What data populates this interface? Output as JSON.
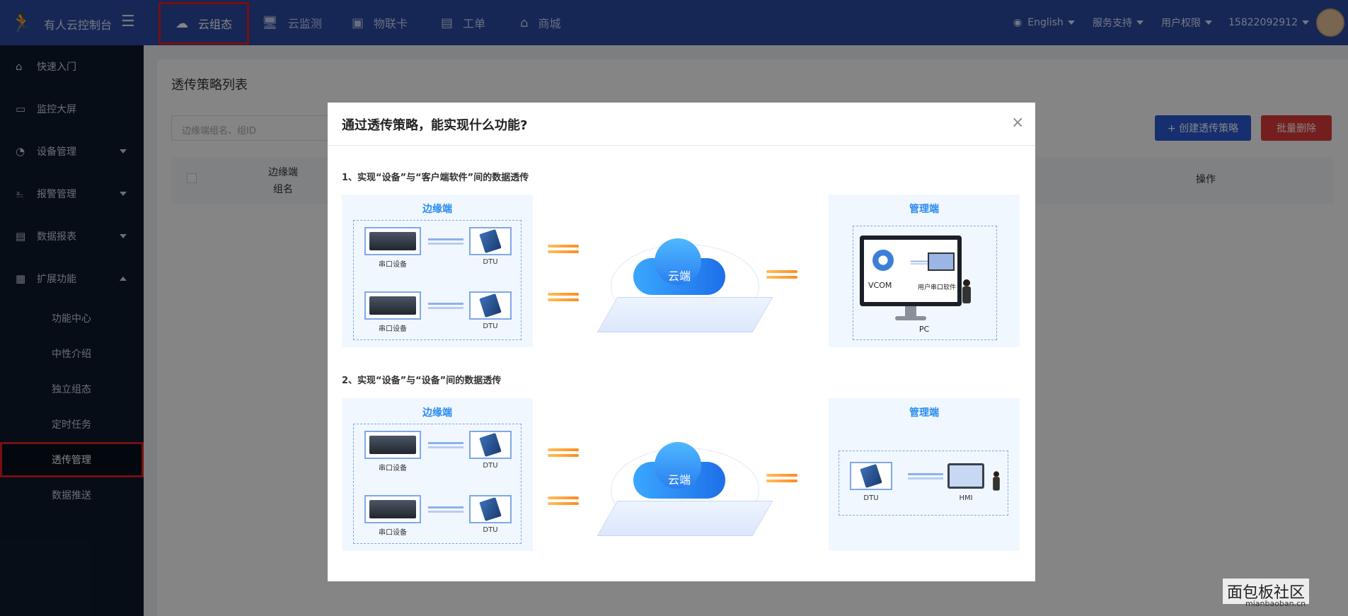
{
  "topbar": {
    "brand": "有人云控制台",
    "nav": [
      {
        "label": "云组态",
        "icon": "cloud-icon"
      },
      {
        "label": "云监测",
        "icon": "monitor-chart-icon"
      },
      {
        "label": "物联卡",
        "icon": "sim-card-icon"
      },
      {
        "label": "工单",
        "icon": "work-order-icon"
      },
      {
        "label": "商城",
        "icon": "store-icon"
      }
    ],
    "language": "English",
    "service": "服务支持",
    "permission": "用户权限",
    "user": "15822092912"
  },
  "sidebar": {
    "items": [
      {
        "label": "快速入门",
        "icon": "home-icon"
      },
      {
        "label": "监控大屏",
        "icon": "screen-icon"
      },
      {
        "label": "设备管理",
        "icon": "device-icon"
      },
      {
        "label": "报警管理",
        "icon": "bell-icon"
      },
      {
        "label": "数据报表",
        "icon": "report-icon"
      },
      {
        "label": "扩展功能",
        "icon": "grid-icon"
      }
    ],
    "sub": [
      "功能中心",
      "中性介绍",
      "独立组态",
      "定时任务",
      "透传管理",
      "数据推送"
    ]
  },
  "page": {
    "title": "透传策略列表",
    "search_placeholder": "边缘端组名、组ID",
    "create_button": "+ 创建透传策略",
    "delete_button": "批量删除",
    "col_group_line1": "边缘端",
    "col_group_line2": "组名",
    "col_ops": "操作"
  },
  "modal": {
    "title": "通过透传策略，能实现什么功能?",
    "section1": "1、实现“设备”与“客户端软件”间的数据透传",
    "section2": "2、实现“设备”与“设备”间的数据透传",
    "edge": "边缘端",
    "manage": "管理端",
    "serial_device": "串口设备",
    "dtu": "DTU",
    "cloud": "云端",
    "vcom": "VCOM",
    "user_serial_software": "用户串口软件",
    "pc": "PC",
    "hmi": "HMI"
  },
  "watermark": {
    "title": "面包板社区",
    "url": "mianbaoban.cn"
  }
}
